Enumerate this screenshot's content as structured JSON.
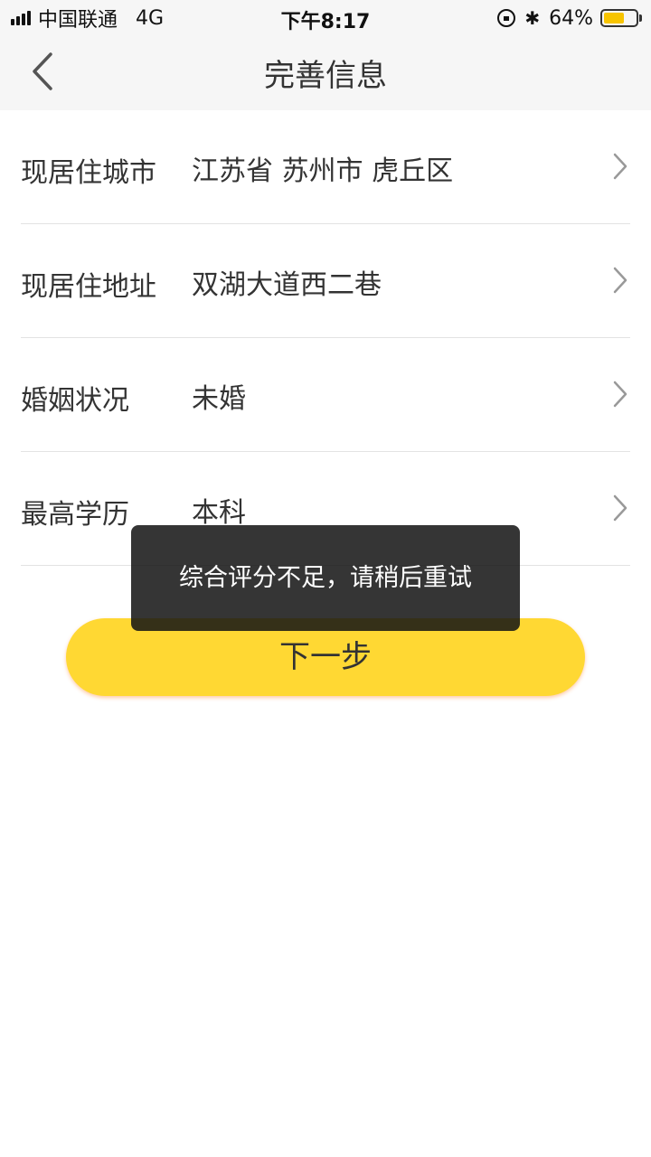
{
  "status_bar": {
    "carrier": "中国联通",
    "network": "4G",
    "time": "下午8:17",
    "bluetooth_symbol": "✱",
    "battery_percent": "64%",
    "battery_level": 0.64,
    "icons": [
      "signal-icon",
      "orientation-lock-icon",
      "bluetooth-icon",
      "battery-icon"
    ]
  },
  "nav": {
    "title": "完善信息",
    "back_icon": "chevron-left-icon"
  },
  "form": {
    "rows": [
      {
        "label": "现居住城市",
        "value": "江苏省 苏州市 虎丘区"
      },
      {
        "label": "现居住地址",
        "value": "双湖大道西二巷"
      },
      {
        "label": "婚姻状况",
        "value": "未婚"
      },
      {
        "label": "最高学历",
        "value": "本科"
      }
    ],
    "row_icon": "chevron-right-icon"
  },
  "next_button": {
    "label": "下一步"
  },
  "toast": {
    "message": "综合评分不足，请稍后重试"
  },
  "colors": {
    "accent": "#ffd833",
    "battery": "#f7c400",
    "toast_bg": "#141414"
  }
}
